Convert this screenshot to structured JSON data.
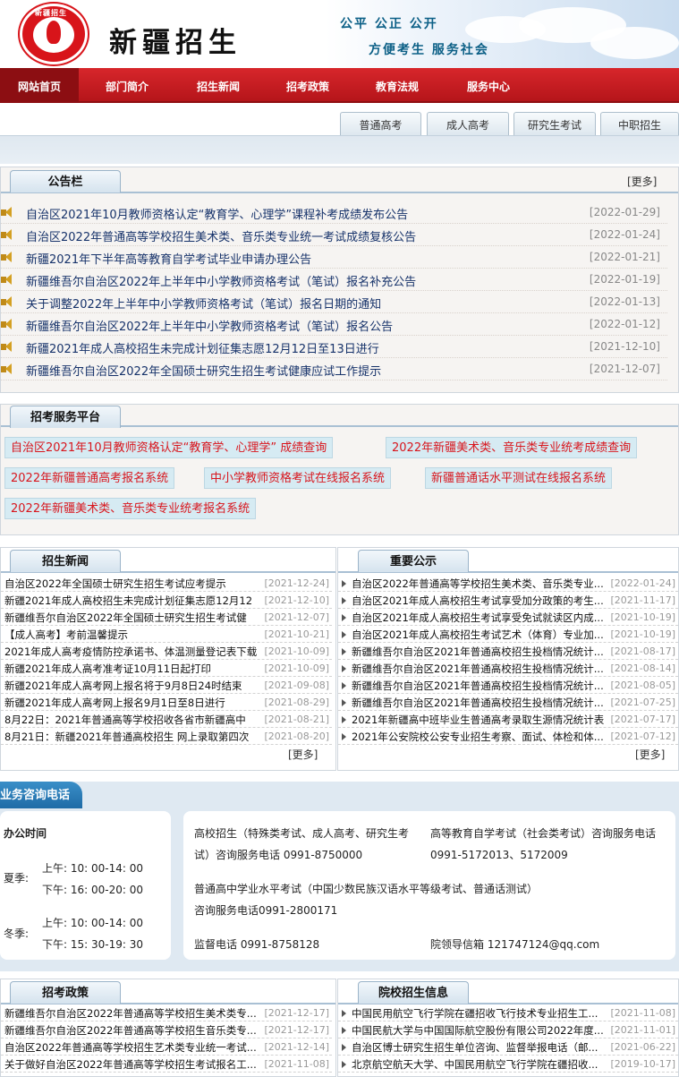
{
  "header": {
    "logo_text": "新疆招生",
    "site_name": "新疆招生",
    "slogan1": "公平  公正  公开",
    "slogan2": "方便考生   服务社会"
  },
  "nav": [
    "网站首页",
    "部门简介",
    "招生新闻",
    "招考政策",
    "教育法规",
    "服务中心"
  ],
  "subtabs": [
    "普通高考",
    "成人高考",
    "研究生考试",
    "中职招生"
  ],
  "notice": {
    "title": "公告栏",
    "more": "[更多]",
    "items": [
      {
        "title": "自治区2021年10月教师资格认定“教育学、心理学”课程补考成绩发布公告",
        "date": "[2022-01-29]"
      },
      {
        "title": "自治区2022年普通高等学校招生美术类、音乐类专业统一考试成绩复核公告",
        "date": "[2022-01-24]"
      },
      {
        "title": "新疆2021年下半年高等教育自学考试毕业申请办理公告",
        "date": "[2022-01-21]"
      },
      {
        "title": "新疆维吾尔自治区2022年上半年中小学教师资格考试（笔试）报名补充公告",
        "date": "[2022-01-19]"
      },
      {
        "title": "关于调整2022年上半年中小学教师资格考试（笔试）报名日期的通知",
        "date": "[2022-01-13]"
      },
      {
        "title": "新疆维吾尔自治区2022年上半年中小学教师资格考试（笔试）报名公告",
        "date": "[2022-01-12]"
      },
      {
        "title": "新疆2021年成人高校招生未完成计划征集志愿12月12日至13日进行",
        "date": "[2021-12-10]"
      },
      {
        "title": "新疆维吾尔自治区2022年全国硕士研究生招生考试健康应试工作提示",
        "date": "[2021-12-07]"
      }
    ]
  },
  "service": {
    "title": "招考服务平台",
    "links": [
      "自治区2021年10月教师资格认定“教育学、心理学” 成绩查询",
      "2022年新疆美术类、音乐类专业统考成绩查询",
      "2022年新疆普通高考报名系统",
      "中小学教师资格考试在线报名系统",
      "新疆普通话水平测试在线报名系统",
      "2022年新疆美术类、音乐类专业统考报名系统"
    ]
  },
  "news": {
    "title": "招生新闻",
    "more": "[更多]",
    "items": [
      {
        "title": "自治区2022年全国硕士研究生招生考试应考提示",
        "date": "[2021-12-24]"
      },
      {
        "title": "新疆2021年成人高校招生未完成计划征集志愿12月12",
        "date": "[2021-12-10]"
      },
      {
        "title": "新疆维吾尔自治区2022年全国硕士研究生招生考试健",
        "date": "[2021-12-07]"
      },
      {
        "title": "【成人高考】考前温馨提示",
        "date": "[2021-10-21]"
      },
      {
        "title": "2021年成人高考疫情防控承诺书、体温测量登记表下载",
        "date": "[2021-10-09]"
      },
      {
        "title": "新疆2021年成人高考准考证10月11日起打印",
        "date": "[2021-10-09]"
      },
      {
        "title": "新疆2021年成人高考网上报名将于9月8日24时结束",
        "date": "[2021-09-08]"
      },
      {
        "title": "新疆2021年成人高考网上报名9月1日至8日进行",
        "date": "[2021-08-29]"
      },
      {
        "title": "8月22日：2021年普通高等学校招收各省市新疆高中",
        "date": "[2021-08-21]"
      },
      {
        "title": "8月21日：新疆2021年普通高校招生 网上录取第四次",
        "date": "[2021-08-20]"
      }
    ]
  },
  "announce": {
    "title": "重要公示",
    "more": "[更多]",
    "items": [
      {
        "title": "自治区2022年普通高等学校招生美术类、音乐类专业...",
        "date": "[2022-01-24]"
      },
      {
        "title": "自治区2021年成人高校招生考试享受加分政策的考生...",
        "date": "[2021-11-17]"
      },
      {
        "title": "自治区2021年成人高校招生考试享受免试就读区内成...",
        "date": "[2021-10-19]"
      },
      {
        "title": "自治区2021年成人高校招生考试艺术（体育）专业加...",
        "date": "[2021-10-19]"
      },
      {
        "title": "新疆维吾尔自治区2021年普通高校招生投档情况统计...",
        "date": "[2021-08-17]"
      },
      {
        "title": "新疆维吾尔自治区2021年普通高校招生投档情况统计...",
        "date": "[2021-08-14]"
      },
      {
        "title": "新疆维吾尔自治区2021年普通高校招生投档情况统计...",
        "date": "[2021-08-05]"
      },
      {
        "title": "新疆维吾尔自治区2021年普通高校招生投档情况统计...",
        "date": "[2021-07-25]"
      },
      {
        "title": "2021年新疆高中班毕业生普通高考录取生源情况统计表",
        "date": "[2021-07-17]"
      },
      {
        "title": "2021年公安院校公安专业招生考察、面试、体检和体...",
        "date": "[2021-07-12]"
      }
    ]
  },
  "consult": {
    "title": "业务咨询电话",
    "office_hours": "办公时间",
    "summer": "夏季:",
    "summer_am": "上午: 10: 00-14: 00",
    "summer_pm": "下午: 16: 00-20: 00",
    "winter": "冬季:",
    "winter_am": "上午: 10: 00-14: 00",
    "winter_pm": "下午: 15: 30-19: 30",
    "line1": "高校招生（特殊类考试、成人高考、研究生考",
    "line2": "试）咨询服务电话 0991-8750000",
    "line3": "高等教育自学考试（社会类考试）咨询服务电话",
    "line4": "0991-5172013、5172009",
    "line5": "普通高中学业水平考试（中国少数民族汉语水平等级考试、普通话测试）",
    "line6": "咨询服务电话0991-2800171",
    "line7": "监督电话  0991-8758128",
    "line8": "院领导信箱  121747124@qq.com"
  },
  "policy": {
    "title": "招考政策",
    "items": [
      {
        "title": "新疆维吾尔自治区2022年普通高等学校招生美术类专...",
        "date": "[2021-12-17]"
      },
      {
        "title": "新疆维吾尔自治区2022年普通高等学校招生音乐类专...",
        "date": "[2021-12-17]"
      },
      {
        "title": "自治区2022年普通高等学校招生艺术类专业统一考试...",
        "date": "[2021-12-14]"
      },
      {
        "title": "关于做好自治区2022年普通高等学校招生考试报名工...",
        "date": "[2021-11-08]"
      }
    ]
  },
  "schools": {
    "title": "院校招生信息",
    "items": [
      {
        "title": "中国民用航空飞行学院在疆招收飞行技术专业招生工...",
        "date": "[2021-11-08]"
      },
      {
        "title": "中国民航大学与中国国际航空股份有限公司2022年度...",
        "date": "[2021-11-01]"
      },
      {
        "title": "自治区博士研究生招生单位咨询、监督举报电话（邮...",
        "date": "[2021-06-22]"
      },
      {
        "title": "北京航空航天大学、中国民用航空飞行学院在疆招收...",
        "date": "[2019-10-17]"
      }
    ]
  }
}
